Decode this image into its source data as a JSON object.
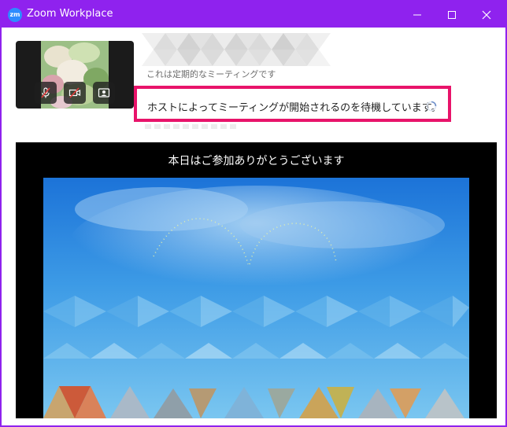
{
  "window": {
    "title": "Zoom Workplace",
    "logo_text": "zm"
  },
  "meeting": {
    "subtitle": "これは定期的なミーティングです",
    "waiting_message": "ホストによってミーティングが開始されるのを待機しています。"
  },
  "video": {
    "title": "本日はご参加ありがとうございます"
  },
  "colors": {
    "titlebar": "#8f22ee",
    "highlight_border": "#e8136a",
    "mute_slash": "#e23b3b"
  }
}
